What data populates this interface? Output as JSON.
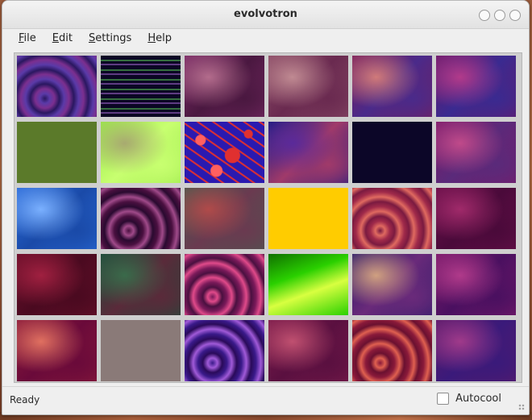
{
  "window": {
    "title": "evolvotron"
  },
  "menu": [
    {
      "label": "File",
      "mnemonic": "F",
      "rest": "ile"
    },
    {
      "label": "Edit",
      "mnemonic": "E",
      "rest": "dit"
    },
    {
      "label": "Settings",
      "mnemonic": "S",
      "rest": "ettings"
    },
    {
      "label": "Help",
      "mnemonic": "H",
      "rest": "elp"
    }
  ],
  "grid": {
    "rows": 5,
    "cols": 6,
    "cells": [
      {
        "style": "swirl",
        "c1": "#2a1760",
        "c2": "#5a3aa8",
        "c3": "#7b2f8f"
      },
      {
        "style": "lines",
        "c1": "#0b0724",
        "c2": "#5fd75a",
        "c3": "#b070e0"
      },
      {
        "style": "cloud",
        "c1": "#7a2a66",
        "c2": "#b36c8c",
        "c3": "#4a1840"
      },
      {
        "style": "cloud",
        "c1": "#8a4a66",
        "c2": "#c08a92",
        "c3": "#6a2a50"
      },
      {
        "style": "cloud",
        "c1": "#7a1e5a",
        "c2": "#d07a7a",
        "c3": "#4a2a8a"
      },
      {
        "style": "cloud",
        "c1": "#6a1a6a",
        "c2": "#b23a8a",
        "c3": "#3a2a90"
      },
      {
        "style": "flat",
        "c1": "#5b7a2a",
        "c2": "#5b7a2a",
        "c3": "#5b7a2a"
      },
      {
        "style": "cloud",
        "c1": "#9ae84a",
        "c2": "#a8aa70",
        "c3": "#c8ff70"
      },
      {
        "style": "noise",
        "c1": "#2a1ab0",
        "c2": "#e03030",
        "c3": "#ff6060"
      },
      {
        "style": "cloud",
        "c1": "#1a1a80",
        "c2": "#5a2a9a",
        "c3": "#a03a6a"
      },
      {
        "style": "flat",
        "c1": "#0c0628",
        "c2": "#0c0628",
        "c3": "#0c0628"
      },
      {
        "style": "cloud",
        "c1": "#7a1a6a",
        "c2": "#c04a8a",
        "c3": "#5a2a7a"
      },
      {
        "style": "cloud",
        "c1": "#2a6ad8",
        "c2": "#7ab0ff",
        "c3": "#1a4aa8"
      },
      {
        "style": "swirl",
        "c1": "#4a1040",
        "c2": "#a04a8a",
        "c3": "#2a0a30"
      },
      {
        "style": "cloud",
        "c1": "#4a5a50",
        "c2": "#b04a4a",
        "c3": "#6a3a50"
      },
      {
        "style": "flat",
        "c1": "#ffcc00",
        "c2": "#ffcc00",
        "c3": "#ffcc00"
      },
      {
        "style": "swirl",
        "c1": "#7a1a40",
        "c2": "#e06a60",
        "c3": "#a02a4a"
      },
      {
        "style": "cloud",
        "c1": "#6a0f4a",
        "c2": "#a02a6a",
        "c3": "#4a0a3a"
      },
      {
        "style": "cloud",
        "c1": "#6a0f2a",
        "c2": "#a02040",
        "c3": "#4a0a20"
      },
      {
        "style": "cloud",
        "c1": "#1e4a3a",
        "c2": "#3a6a4a",
        "c3": "#5a2a3a"
      },
      {
        "style": "swirl",
        "c1": "#7a1a5a",
        "c2": "#e04a8a",
        "c3": "#4a1040"
      },
      {
        "style": "gradient",
        "c1": "#2ad000",
        "c2": "#d8ff40",
        "c3": "#107000"
      },
      {
        "style": "cloud",
        "c1": "#2a1a6a",
        "c2": "#d0a080",
        "c3": "#6a2a7a"
      },
      {
        "style": "cloud",
        "c1": "#7a1a6a",
        "c2": "#b03a8a",
        "c3": "#4a1060"
      },
      {
        "style": "cloud",
        "c1": "#8a1a3a",
        "c2": "#e07060",
        "c3": "#6a0a3a"
      },
      {
        "style": "flat",
        "c1": "#8a7a78",
        "c2": "#8a7a78",
        "c3": "#8a7a78"
      },
      {
        "style": "swirl",
        "c1": "#3a1a8a",
        "c2": "#a05ad8",
        "c3": "#2a0a5a"
      },
      {
        "style": "cloud",
        "c1": "#7a1a4a",
        "c2": "#c05070",
        "c3": "#5a1040"
      },
      {
        "style": "swirl",
        "c1": "#8a1a3a",
        "c2": "#e06050",
        "c3": "#6a1030"
      },
      {
        "style": "cloud",
        "c1": "#5a1a6a",
        "c2": "#a03a8a",
        "c3": "#3a1a7a"
      }
    ]
  },
  "status": {
    "text": "Ready",
    "autocool_label": "Autocool"
  }
}
